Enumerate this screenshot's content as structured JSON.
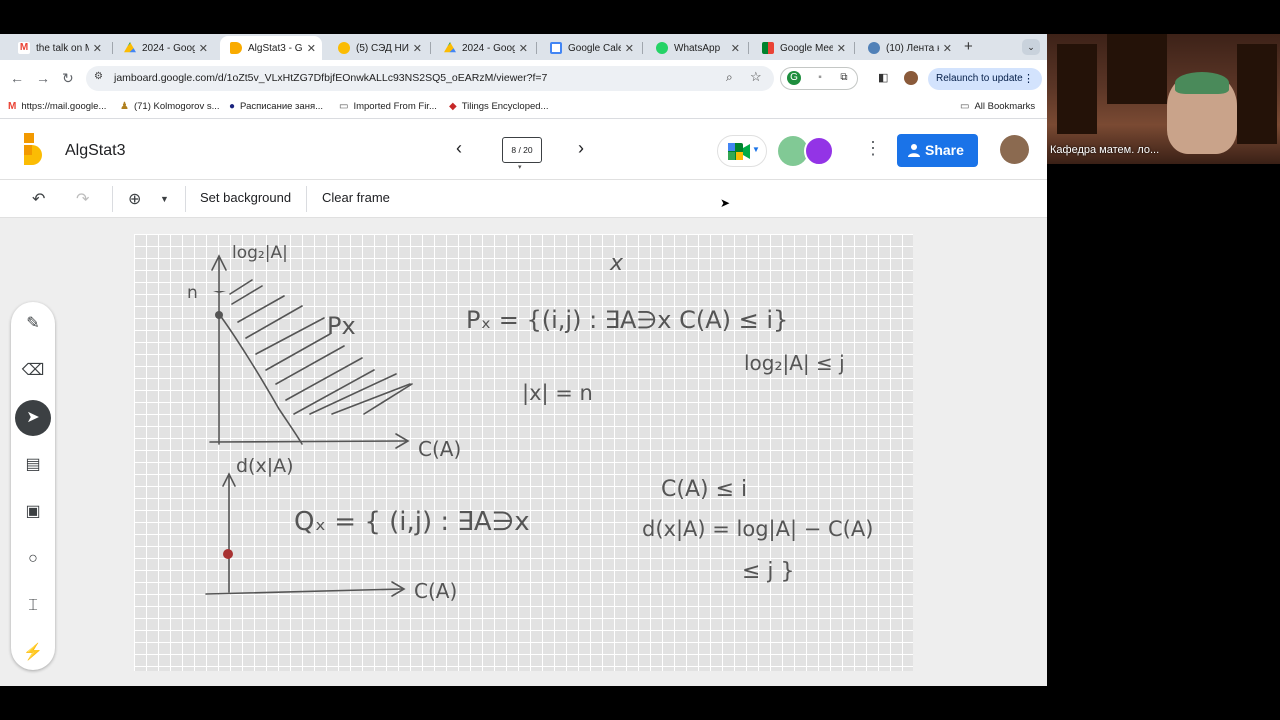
{
  "browser": {
    "tabs": [
      {
        "label": "the talk on M",
        "icon": "gmail-icon",
        "color": "#ea4335"
      },
      {
        "label": "2024 - Goog",
        "icon": "drive-icon",
        "color": "#34a853"
      },
      {
        "label": "AlgStat3 - G",
        "icon": "jamboard-icon",
        "color": "#f9ab00",
        "active": true
      },
      {
        "label": "(5) СЭД НИУ",
        "icon": "sed-icon",
        "color": "#fbbc04"
      },
      {
        "label": "2024 - Goog",
        "icon": "drive-icon",
        "color": "#34a853"
      },
      {
        "label": "Google Caler",
        "icon": "calendar-icon",
        "color": "#4285f4"
      },
      {
        "label": "WhatsApp",
        "icon": "whatsapp-icon",
        "color": "#25d366"
      },
      {
        "label": "Google Meet",
        "icon": "meet-icon",
        "color": "#00832d"
      },
      {
        "label": "(10) Лента н",
        "icon": "vk-icon",
        "color": "#5181b8"
      }
    ],
    "url": "jamboard.google.com/d/1oZt5v_VLxHtZG7DfbjfEOnwkALLc93NS2SQ5_oEARzM/viewer?f=7",
    "relaunch_label": "Relaunch to update",
    "bookmarks": [
      {
        "label": "https://mail.google...",
        "icon": "M"
      },
      {
        "label": "(71) Kolmogorov s...",
        "icon": "♟"
      },
      {
        "label": "Расписание заня...",
        "icon": "●"
      },
      {
        "label": "Imported From Fir...",
        "icon": "▭"
      },
      {
        "label": "Tilings Encycloped...",
        "icon": "◆"
      }
    ],
    "all_bookmarks_label": "All Bookmarks"
  },
  "jamboard": {
    "title": "AlgStat3",
    "frame_counter": "8 / 20",
    "share_label": "Share",
    "toolbar": {
      "set_background": "Set background",
      "clear_frame": "Clear frame"
    },
    "handwriting": {
      "title_var": "x",
      "y_axis_top": "log₂|A|",
      "n_mark": "n",
      "region_label": "Px",
      "x_axis_top": "C(A)",
      "y_axis_bottom": "d(x|A)",
      "x_axis_bottom": "C(A)",
      "def_P_line1": "Pₓ = {(i,j) : ∃A∋x  C(A) ≤ i}",
      "def_P_line2": "log₂|A| ≤ j",
      "length": "|x| = n",
      "def_Q_part1": "Qₓ = { (i,j) : ∃A∋x",
      "def_Q_cond1": "C(A) ≤ i",
      "def_Q_cond2": "d(x|A) = log|A| − C(A)",
      "def_Q_cond3": "≤ j }"
    }
  },
  "webcam": {
    "name": "Кафедра матем. ло..."
  },
  "colors": {
    "accent": "#1a73e8",
    "dot": "#a83232"
  }
}
